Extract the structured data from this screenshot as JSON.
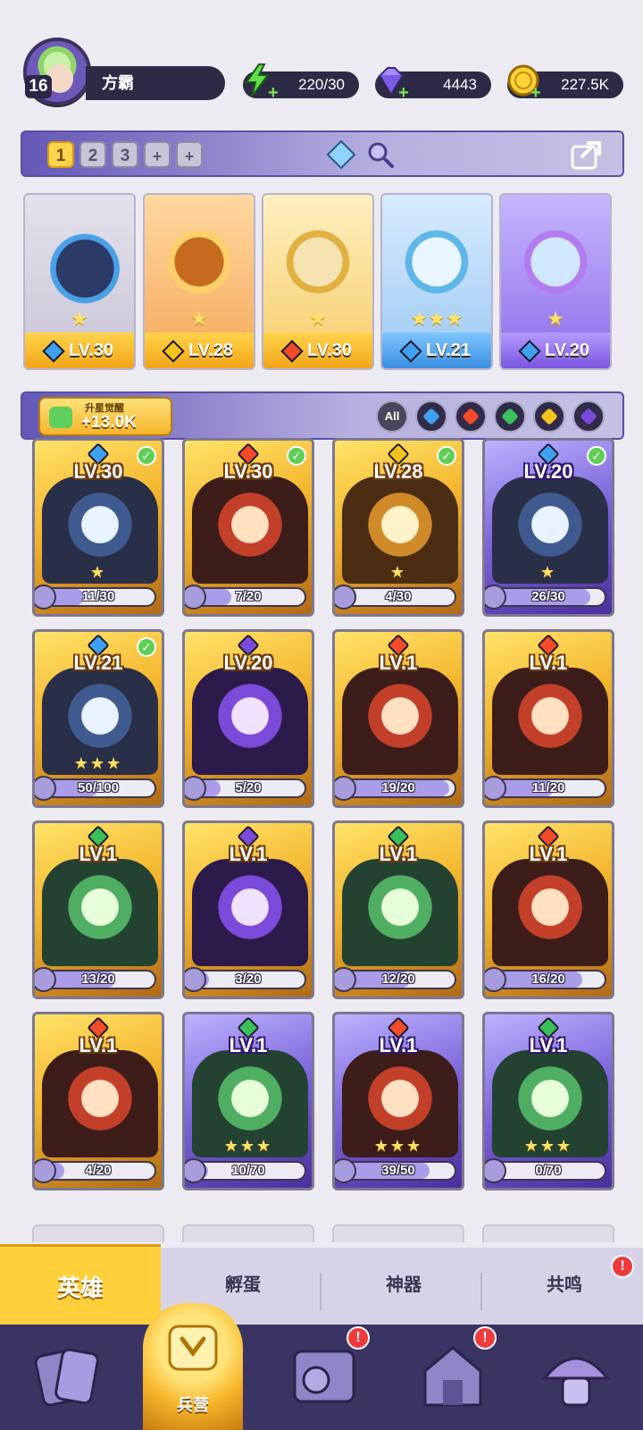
{
  "player": {
    "level": "16",
    "name": "方霸"
  },
  "resources": {
    "energy": "220/30",
    "gems": "4443",
    "gold": "227.5K"
  },
  "team_tabs": [
    "1",
    "2",
    "3",
    "+",
    "+"
  ],
  "team_heroes": [
    {
      "level": "LV.30",
      "element": "water",
      "stars": "★"
    },
    {
      "level": "LV.28",
      "element": "light",
      "stars": "★"
    },
    {
      "level": "LV.30",
      "element": "fire",
      "stars": "★"
    },
    {
      "level": "LV.21",
      "element": "water",
      "stars": "★★★"
    },
    {
      "level": "LV.20",
      "element": "water",
      "stars": "★"
    }
  ],
  "awaken": {
    "label": "升星觉醒",
    "value": "+13.0K"
  },
  "filters": [
    "All",
    "water",
    "fire",
    "wind",
    "light",
    "dark"
  ],
  "heroes": [
    {
      "level": "LV.30",
      "element": "water",
      "shards": "11/30",
      "fill": 0.37,
      "checked": true,
      "stars": "★",
      "frame": "gold"
    },
    {
      "level": "LV.30",
      "element": "fire",
      "shards": "7/20",
      "fill": 0.35,
      "checked": true,
      "stars": "",
      "frame": "gold"
    },
    {
      "level": "LV.28",
      "element": "light",
      "shards": "4/30",
      "fill": 0.13,
      "checked": true,
      "stars": "★",
      "frame": "gold"
    },
    {
      "level": "LV.20",
      "element": "water",
      "shards": "26/30",
      "fill": 0.87,
      "checked": true,
      "stars": "★",
      "frame": "purple"
    },
    {
      "level": "LV.21",
      "element": "water",
      "shards": "50/100",
      "fill": 0.5,
      "checked": true,
      "stars": "★★★",
      "frame": "gold"
    },
    {
      "level": "LV.20",
      "element": "dark",
      "shards": "5/20",
      "fill": 0.25,
      "checked": false,
      "stars": "",
      "frame": "gold"
    },
    {
      "level": "LV.1",
      "element": "fire",
      "shards": "19/20",
      "fill": 0.95,
      "checked": false,
      "stars": "",
      "frame": "gold"
    },
    {
      "level": "LV.1",
      "element": "fire",
      "shards": "11/20",
      "fill": 0.55,
      "checked": false,
      "stars": "",
      "frame": "gold"
    },
    {
      "level": "LV.1",
      "element": "wind",
      "shards": "13/20",
      "fill": 0.65,
      "checked": false,
      "stars": "",
      "frame": "gold"
    },
    {
      "level": "LV.1",
      "element": "dark",
      "shards": "3/20",
      "fill": 0.15,
      "checked": false,
      "stars": "",
      "frame": "gold"
    },
    {
      "level": "LV.1",
      "element": "wind",
      "shards": "12/20",
      "fill": 0.6,
      "checked": false,
      "stars": "",
      "frame": "gold"
    },
    {
      "level": "LV.1",
      "element": "fire",
      "shards": "16/20",
      "fill": 0.8,
      "checked": false,
      "stars": "",
      "frame": "gold"
    },
    {
      "level": "LV.1",
      "element": "fire",
      "shards": "4/20",
      "fill": 0.2,
      "checked": false,
      "stars": "",
      "frame": "gold"
    },
    {
      "level": "LV.1",
      "element": "wind",
      "shards": "10/70",
      "fill": 0.14,
      "checked": false,
      "stars": "★★★",
      "frame": "purple"
    },
    {
      "level": "LV.1",
      "element": "fire",
      "shards": "39/50",
      "fill": 0.78,
      "checked": false,
      "stars": "★★★",
      "frame": "purple"
    },
    {
      "level": "LV.1",
      "element": "wind",
      "shards": "0/70",
      "fill": 0.0,
      "checked": false,
      "stars": "★★★",
      "frame": "purple"
    }
  ],
  "sub_tabs": [
    "英雄",
    "孵蛋",
    "神器",
    "共鸣"
  ],
  "bottom_nav": {
    "active_label": "兵营",
    "badge": "!"
  },
  "colors": {
    "water": "#3fa0f0",
    "fire": "#f24a2a",
    "wind": "#3bbf5a",
    "light": "#f5c21e",
    "dark": "#7a4ad8"
  }
}
